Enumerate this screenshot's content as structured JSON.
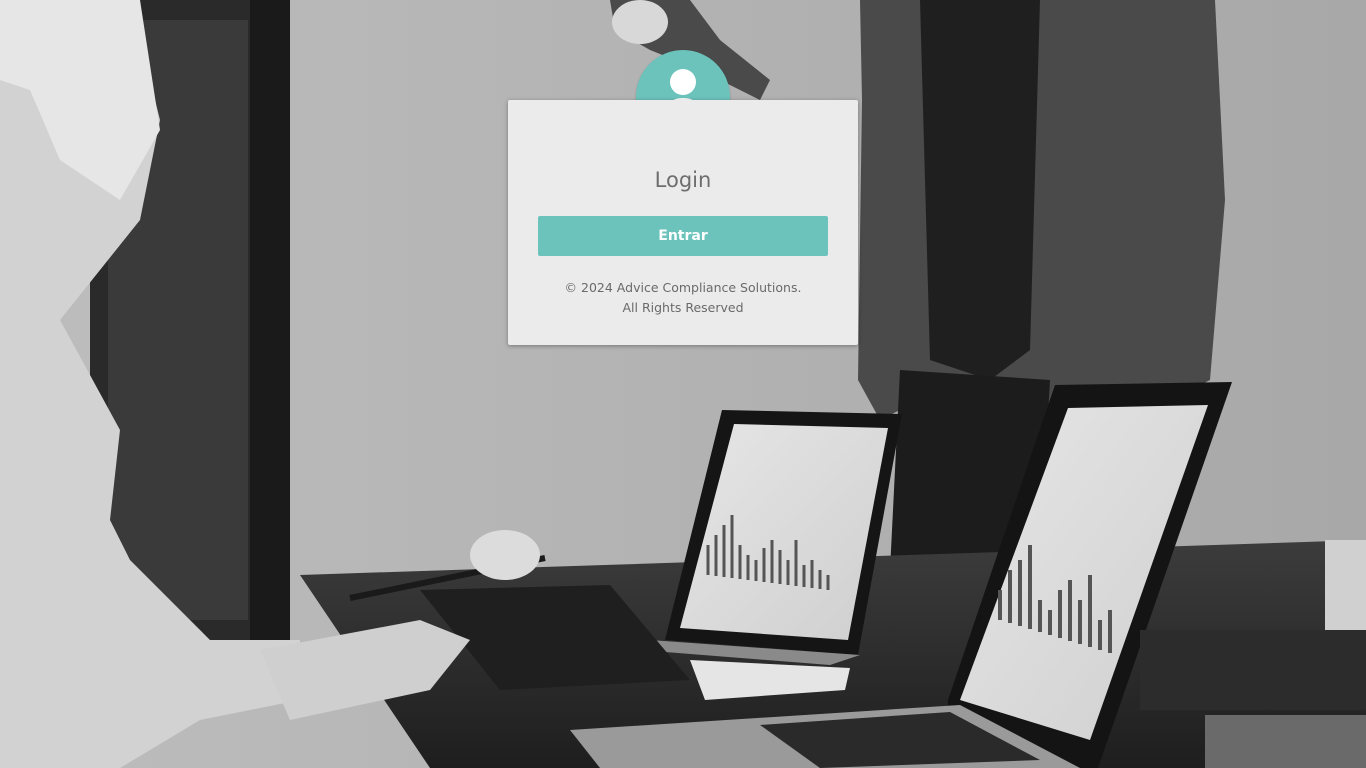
{
  "background": {
    "description_icon": "office-meeting-photo"
  },
  "login": {
    "title": "Login",
    "button_label": "Entrar",
    "copyright_line1": "© 2024 Advice Compliance Solutions.",
    "copyright_line2": "All Rights Reserved",
    "avatar_icon": "user-icon"
  },
  "colors": {
    "accent": "#6cc3bc",
    "card": "#ebebeb",
    "text": "#6e6e6e"
  }
}
